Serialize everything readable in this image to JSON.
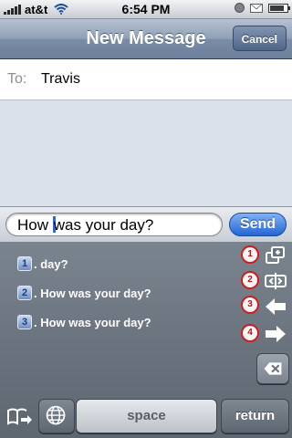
{
  "status_bar": {
    "carrier": "at&t",
    "time": "6:54 PM",
    "battery_level": 0.85,
    "icons": [
      "signal-icon",
      "wifi-icon",
      "lock-icon",
      "mail-icon",
      "battery-icon"
    ]
  },
  "nav": {
    "title": "New Message",
    "cancel_label": "Cancel"
  },
  "recipient": {
    "label": "To:",
    "value": "Travis"
  },
  "compose": {
    "text_before_caret": "How ",
    "text_after_caret": "was your day?",
    "send_label": "Send"
  },
  "suggestions": [
    {
      "number": "1",
      "text": ". day?"
    },
    {
      "number": "2",
      "text": ". How was your day?"
    },
    {
      "number": "3",
      "text": ". How was your day?"
    }
  ],
  "side_markers": [
    "1",
    "2",
    "3",
    "4"
  ],
  "side_icons": [
    "copy-icon",
    "cursor-move-icon",
    "arrow-left-icon",
    "arrow-right-icon"
  ],
  "keyboard": {
    "space_label": "space",
    "return_label": "return"
  },
  "colors": {
    "send": "#2565d6",
    "marker_ring": "#d01d1d",
    "nav": "#7a8ca6"
  }
}
